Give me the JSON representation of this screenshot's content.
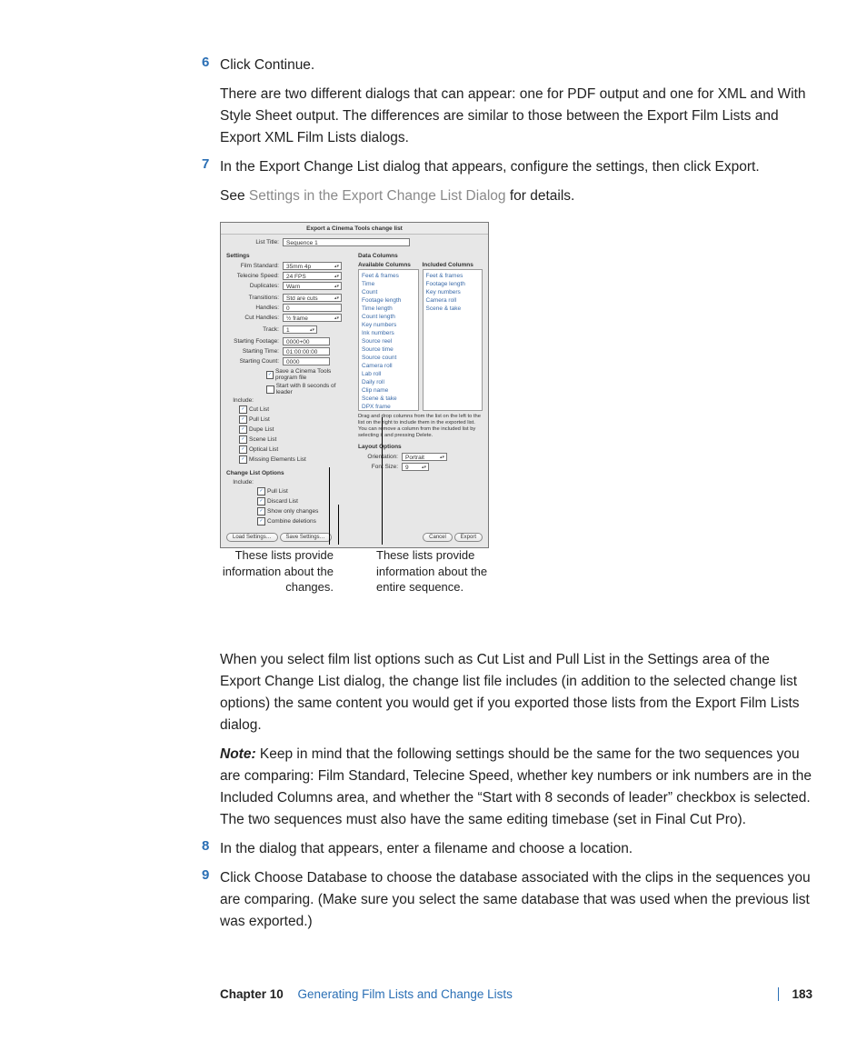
{
  "steps": {
    "s6": {
      "num": "6",
      "text": "Click Continue.",
      "para": "There are two different dialogs that can appear: one for PDF output and one for XML and With Style Sheet output. The differences are similar to those between the Export Film Lists and Export XML Film Lists dialogs."
    },
    "s7": {
      "num": "7",
      "text": "In the Export Change List dialog that appears, configure the settings, then click Export.",
      "para_pre": "See ",
      "para_link": "Settings in the Export Change List Dialog",
      "para_post": " for details."
    },
    "s8": {
      "num": "8",
      "text": "In the dialog that appears, enter a filename and choose a location."
    },
    "s9": {
      "num": "9",
      "text": "Click Choose Database to choose the database associated with the clips in the sequences you are comparing. (Make sure you select the same database that was used when the previous list was exported.)"
    }
  },
  "body_para": "When you select film list options such as Cut List and Pull List in the Settings area of the Export Change List dialog, the change list file includes (in addition to the selected change list options) the same content you would get if you exported those lists from the Export Film Lists dialog.",
  "note": {
    "label": "Note:",
    "text": "  Keep in mind that the following settings should be the same for the two sequences you are comparing: Film Standard, Telecine Speed, whether key numbers or ink numbers are in the Included Columns area, and whether the “Start with 8 seconds of leader” checkbox is selected. The two sequences must also have the same editing timebase (set in Final Cut Pro)."
  },
  "dialog": {
    "title": "Export a Cinema Tools change list",
    "list_title_lbl": "List Title:",
    "list_title_val": "Sequence 1",
    "settings_hd": "Settings",
    "datacols_hd": "Data Columns",
    "avail_hd": "Available Columns",
    "incl_hd": "Included Columns",
    "fields": {
      "film_std": {
        "l": "Film Standard:",
        "v": "35mm 4p"
      },
      "telecine": {
        "l": "Telecine Speed:",
        "v": "24 FPS"
      },
      "duplicates": {
        "l": "Duplicates:",
        "v": "Warn"
      },
      "transitions": {
        "l": "Transitions:",
        "v": "Std are cuts"
      },
      "handles": {
        "l": "Handles:",
        "v": "0"
      },
      "cut_handles": {
        "l": "Cut Handles:",
        "v": "½ frame"
      },
      "track": {
        "l": "Track:",
        "v": "1"
      },
      "start_footage": {
        "l": "Starting Footage:",
        "v": "0000+00"
      },
      "start_time": {
        "l": "Starting Time:",
        "v": "01:00:00:00"
      },
      "start_count": {
        "l": "Starting Count:",
        "v": "0000"
      }
    },
    "save_prog": "Save a Cinema Tools program file",
    "start_leader": "Start with 8 seconds of leader",
    "include_lbl": "Include:",
    "include": [
      "Cut List",
      "Pull List",
      "Dupe List",
      "Scene List",
      "Optical List",
      "Missing Elements List"
    ],
    "clo_hd": "Change List Options",
    "clo_include_lbl": "Include:",
    "clo": [
      "Pull List",
      "Discard List",
      "Show only changes",
      "Combine deletions"
    ],
    "layout_hd": "Layout Options",
    "orient": {
      "l": "Orientation:",
      "v": "Portrait"
    },
    "fontsize": {
      "l": "Font Size:",
      "v": "9"
    },
    "avail": [
      "Feet & frames",
      "Time",
      "Count",
      "Footage length",
      "Time length",
      "Count length",
      "Key numbers",
      "Ink numbers",
      "Source reel",
      "Source time",
      "Source count",
      "Camera roll",
      "Lab roll",
      "Daily roll",
      "Clip name",
      "Scene & take",
      "DPX frame"
    ],
    "incl": [
      "Feet & frames",
      "Footage length",
      "Key numbers",
      "Camera roll",
      "Scene & take"
    ],
    "hint": "Drag and drop columns from the list on the left to the list on the right to include them in the exported list. You can remove a column from the included list by selecting it and pressing Delete.",
    "btn_load": "Load Settings…",
    "btn_save": "Save Settings…",
    "btn_cancel": "Cancel",
    "btn_export": "Export"
  },
  "annot": {
    "left": "These lists provide information about the changes.",
    "right": "These lists provide information about the entire sequence."
  },
  "footer": {
    "chapter": "Chapter 10",
    "title": "Generating Film Lists and Change Lists",
    "page": "183"
  }
}
